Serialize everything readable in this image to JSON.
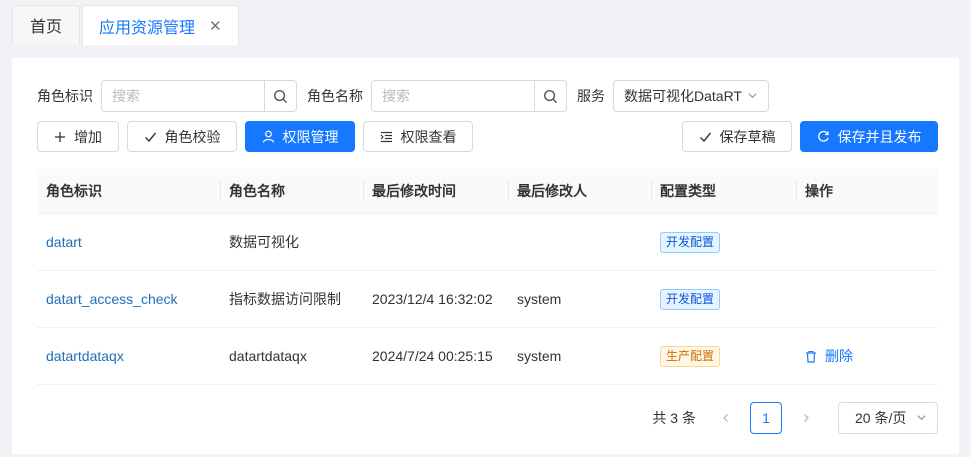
{
  "tabs": [
    {
      "label": "首页"
    },
    {
      "label": "应用资源管理"
    }
  ],
  "filters": {
    "role_id_label": "角色标识",
    "role_id_placeholder": "搜索",
    "role_name_label": "角色名称",
    "role_name_placeholder": "搜索",
    "service_label": "服务",
    "service_value": "数据可视化DataRT"
  },
  "toolbar": {
    "add": "增加",
    "check": "角色校验",
    "perm_manage": "权限管理",
    "perm_view": "权限查看",
    "save_draft": "保存草稿",
    "save_publish": "保存并且发布"
  },
  "table": {
    "headers": [
      "角色标识",
      "角色名称",
      "最后修改时间",
      "最后修改人",
      "配置类型",
      "操作"
    ],
    "rows": [
      {
        "id": "datart",
        "name": "数据可视化",
        "time": "",
        "user": "",
        "type": "开发配置",
        "type_kind": "dev",
        "action": ""
      },
      {
        "id": "datart_access_check",
        "name": "指标数据访问限制",
        "time": "2023/12/4 16:32:02",
        "user": "system",
        "type": "开发配置",
        "type_kind": "dev",
        "action": ""
      },
      {
        "id": "datartdataqx",
        "name": "datartdataqx",
        "time": "2024/7/24 00:25:15",
        "user": "system",
        "type": "生产配置",
        "type_kind": "prod",
        "action": "删除"
      }
    ]
  },
  "pagination": {
    "total": "共 3 条",
    "current": "1",
    "page_size": "20 条/页"
  },
  "colors": {
    "primary": "#1677ff",
    "link": "#1f6fb8"
  }
}
